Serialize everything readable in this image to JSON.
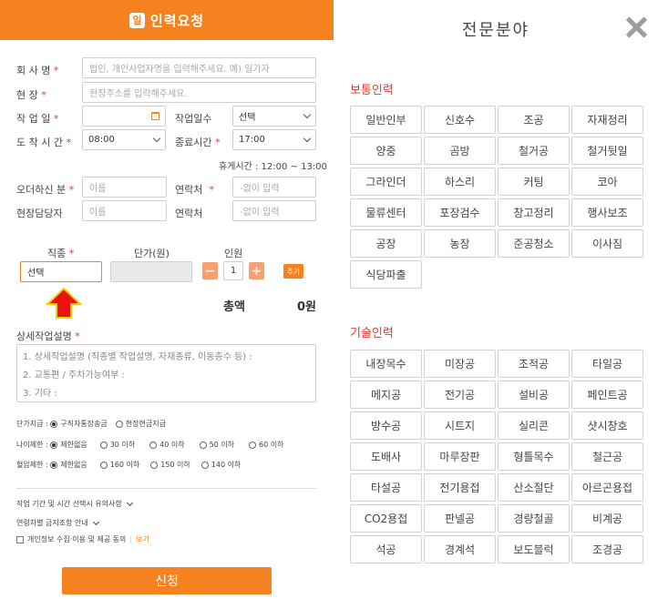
{
  "left": {
    "header": {
      "logo_glyph": "일",
      "title": "인력요청"
    },
    "company": {
      "label": "회 사 명",
      "placeholder": "법인, 개인사업자명을 입력해주세요. 예) 일가자"
    },
    "site": {
      "label": "현 장",
      "placeholder": "현장주소를 입력해주세요."
    },
    "work_date": {
      "label": "작 업 일"
    },
    "work_days": {
      "label": "작업일수",
      "value": "선택"
    },
    "arrival": {
      "label": "도 착 시 간",
      "value": "08:00"
    },
    "end_time": {
      "label": "종료시간",
      "value": "17:00"
    },
    "break_time": "휴게시간 : 12:00 ~ 13:00",
    "orderer": {
      "label": "오더하신 분",
      "placeholder": "이름"
    },
    "orderer_contact": {
      "label": "연락처",
      "placeholder": "-없이 입력"
    },
    "manager": {
      "label": "현장담당자",
      "placeholder": "이름"
    },
    "manager_contact": {
      "label": "연락처",
      "placeholder": "-없이 입력"
    },
    "job": {
      "col_type": "직종",
      "col_price": "단가(원)",
      "col_people": "인원",
      "type_value": "선택",
      "qty": "1",
      "minus": "−",
      "plus": "+",
      "add": "추가"
    },
    "total": {
      "label": "총액",
      "value": "0원"
    },
    "detail": {
      "label": "상세작업설명",
      "lines": [
        "1. 상세작업설명 (직종별 작업설명, 자재종류, 이동층수 등) :",
        "2. 교통편 / 주차가능여부 :",
        "3. 기타 :"
      ]
    },
    "pay": {
      "label": "단가지급 :",
      "opt1": "구직자통장송금",
      "opt2": "현장현금지급"
    },
    "age": {
      "label": "나이제한 :",
      "opts": [
        "제한없음",
        "30 이하",
        "40 이하",
        "50 이하",
        "60 이하"
      ]
    },
    "bp": {
      "label": "혈압제한 :",
      "opts": [
        "제한없음",
        "160 이하",
        "150 이하",
        "140 이하"
      ]
    },
    "notice1": "작업 기간 및 시간 선택시 유의사항",
    "notice2": "연령차별 금지조항 안내",
    "privacy": {
      "text": "개인정보 수집·이용 및 제공 동의",
      "link": "보기"
    },
    "submit": "신청",
    "accent": "#f5821f",
    "required_color": "#e53935"
  },
  "right": {
    "title": "전문분야",
    "close_icon": "close-icon",
    "section1": {
      "title": "보통인력",
      "items": [
        "일반인부",
        "신호수",
        "조공",
        "자재정리",
        "양중",
        "곰방",
        "철거공",
        "철거뒷일",
        "그라인더",
        "하스리",
        "커팅",
        "코아",
        "물류센터",
        "포장검수",
        "창고정리",
        "행사보조",
        "공장",
        "농장",
        "준공청소",
        "이사짐",
        "식당파출"
      ]
    },
    "section2": {
      "title": "기술인력",
      "items": [
        "내장목수",
        "미장공",
        "조적공",
        "타일공",
        "메지공",
        "전기공",
        "설비공",
        "페인트공",
        "방수공",
        "시트지",
        "실리콘",
        "샷시창호",
        "도배사",
        "마루장판",
        "형틀목수",
        "철근공",
        "타설공",
        "전기용접",
        "산소절단",
        "아르곤용접",
        "CO2용접",
        "판넬공",
        "경량철골",
        "비계공",
        "석공",
        "경계석",
        "보도블럭",
        "조경공"
      ]
    }
  }
}
